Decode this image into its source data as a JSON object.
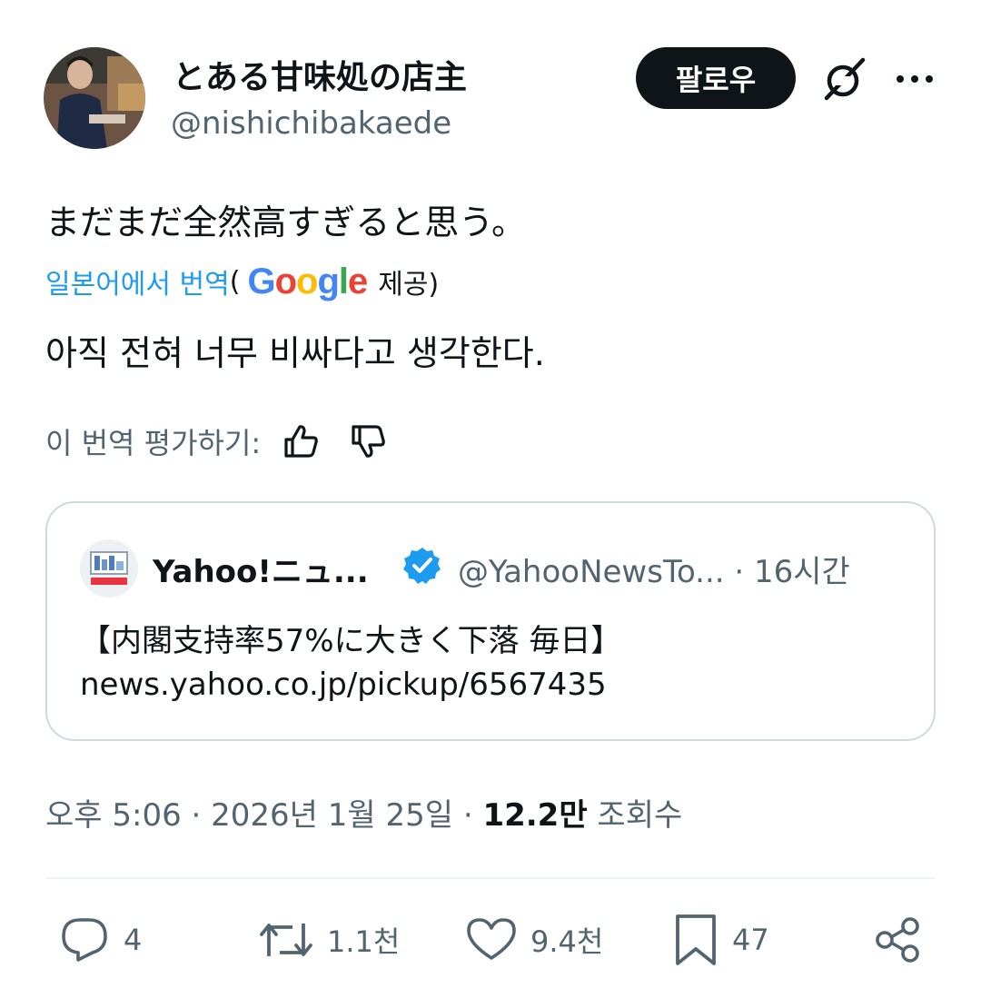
{
  "author": {
    "display_name": "とある甘味処の店主",
    "handle": "@nishichibakaede"
  },
  "header": {
    "follow_label": "팔로우",
    "grok_icon": "grok-icon",
    "more_icon": "more-icon"
  },
  "tweet": {
    "text": "まだまだ全然高すぎると思う。",
    "translate_link": "일본어에서 번역",
    "translate_paren_open": "(",
    "google_logo": "Google",
    "translate_provided": "제공)",
    "translated_text": "아직 전혀 너무 비싸다고 생각한다.",
    "rate_label": "이 번역 평가하기:"
  },
  "quote": {
    "name": "Yahoo!ニュ...",
    "handle_time": "@YahooNewsTo... · 16시간",
    "text_line1": "【内閣支持率57%に大きく下落 毎日】",
    "text_line2": "news.yahoo.co.jp/pickup/6567435"
  },
  "meta": {
    "time_date": "오후 5:06 · 2026년 1월 25일 · ",
    "views_count": "12.2만",
    "views_label": " 조회수"
  },
  "actions": {
    "replies": "4",
    "reposts": "1.1천",
    "likes": "9.4천",
    "bookmarks": "47"
  },
  "colors": {
    "link": "#1d9bf0",
    "muted": "#536471",
    "text": "#0f1419",
    "border": "#cfd9de",
    "verified": "#1d9bf0"
  }
}
